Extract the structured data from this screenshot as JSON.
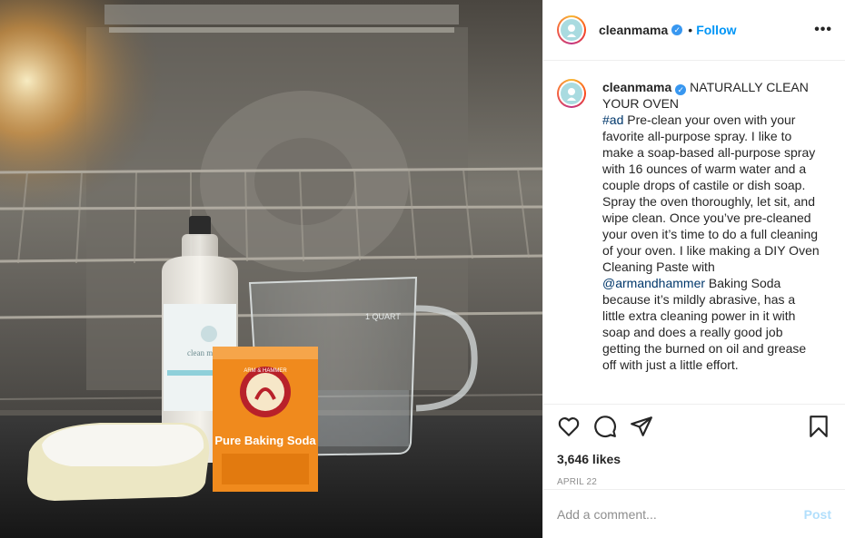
{
  "post": {
    "username": "cleanmama",
    "verified_mark": "✓",
    "follow_label": "Follow",
    "separator": "•",
    "more_label": "•••",
    "caption_title": "NATURALLY CLEAN YOUR OVEN",
    "caption_hashtag": "#ad",
    "caption_part1": " Pre-clean your oven with your favorite all-purpose spray. I like to make a soap-based all-purpose spray with 16 ounces of warm water and a couple drops of castile or dish soap. Spray the oven thoroughly, let sit, and wipe clean. Once you’ve pre-cleaned your oven it’s time to do a full cleaning of your oven. I like making a DIY Oven Cleaning Paste with ",
    "caption_mention": "@armandhammer",
    "caption_part2": " Baking Soda because it’s mildly abrasive, has a little extra cleaning power in it with soap and does a really good job getting the burned on oil and grease off with just a little effort.",
    "likes": "3,646 likes",
    "date": "APRIL 22",
    "comment_placeholder": "Add a comment...",
    "post_label": "Post"
  },
  "photo": {
    "bottle_label": "clean mama",
    "box_brand": "ARM & HAMMER",
    "box_title": "Pure Baking Soda",
    "cup_label": "1 QUART"
  },
  "icons": [
    "heart-icon",
    "comment-icon",
    "share-icon",
    "bookmark-icon",
    "more-icon",
    "verified-icon"
  ],
  "colors": {
    "accent": "#0095f6",
    "verified": "#3897f0",
    "mention": "#00376b",
    "box_orange": "#f28a1c"
  }
}
